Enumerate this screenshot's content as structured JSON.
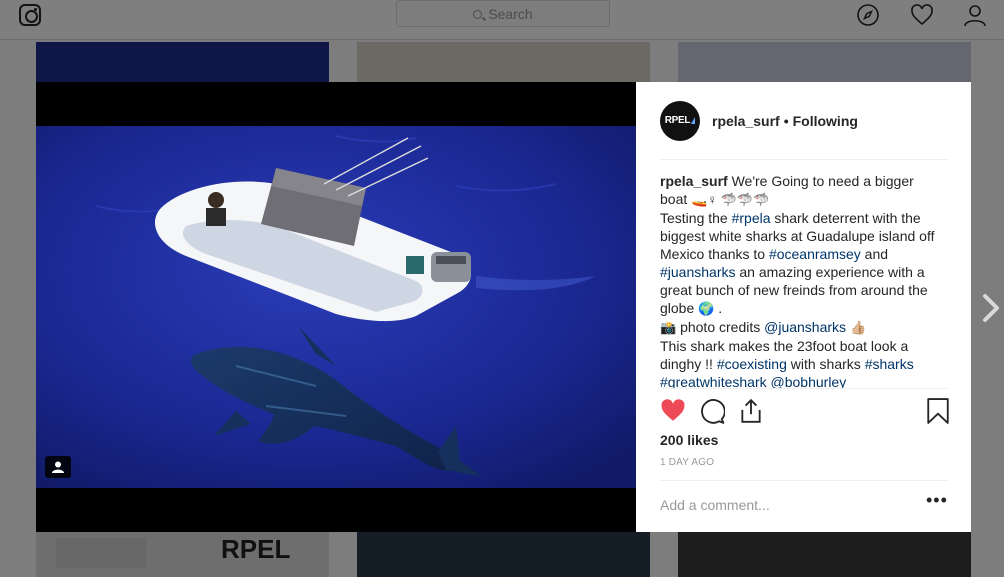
{
  "nav": {
    "search_placeholder": "Search",
    "icons": [
      "instagram-logo-icon",
      "compass-icon",
      "heart-icon",
      "user-icon"
    ]
  },
  "post": {
    "username": "rpela_surf",
    "separator": "•",
    "follow_status": "Following",
    "avatar_text": "RPEL",
    "caption": {
      "l1a": "We're Going to need a bigger",
      "l2a": "boat",
      "l2_emoji": "🚤♀ 🦈🦈🦈",
      "l3a": "Testing the ",
      "l3tag": "#rpela",
      "l3b": " shark deterrent with the",
      "l4": "biggest white sharks at Guadalupe island off",
      "l5a": "Mexico thanks to ",
      "l5tag": "#oceanramsey",
      "l5b": " and",
      "l6tag": "#juansharks",
      "l6b": " an amazing experience with a",
      "l7": "great bunch of new freinds from around the",
      "l8a": "globe",
      "l8_emoji": "🌍",
      "l8b": " .",
      "l9_emoji": "📸",
      "l9a": " photo credits ",
      "l9tag": "@juansharks",
      "l9_emoji2": "👍🏼",
      "l10": "This shark makes the 23foot boat look a",
      "l11a": "dinghy !! ",
      "l11tag": "#coexisting",
      "l11b": " with sharks ",
      "l11tag2": "#sharks",
      "l12tag": "#greatwhiteshark",
      "l12sp": " ",
      "l12tag2": "@bobhurley"
    },
    "likes": "200 likes",
    "time_ago": "1 DAY AGO",
    "comment_placeholder": "Add a comment...",
    "more_label": "•••",
    "liked": true
  },
  "colors": {
    "like_red": "#ed4956",
    "link_blue": "#003569",
    "ocean": "#1d2a9e"
  }
}
